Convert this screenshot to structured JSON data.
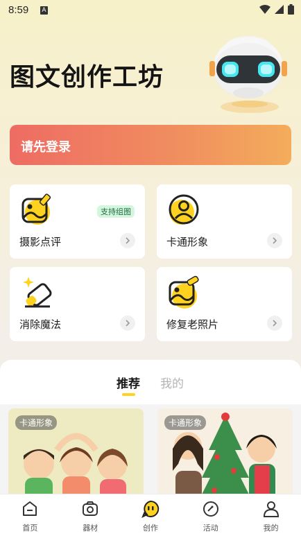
{
  "status": {
    "time": "8:59",
    "notif": "A"
  },
  "hero": {
    "title": "图文创作工坊"
  },
  "login": {
    "label": "请先登录"
  },
  "features": [
    {
      "label": "摄影点评",
      "badge": "支持组图",
      "icon": "photo-review-icon"
    },
    {
      "label": "卡通形象",
      "icon": "cartoon-avatar-icon"
    },
    {
      "label": "消除魔法",
      "icon": "eraser-magic-icon"
    },
    {
      "label": "修复老照片",
      "icon": "photo-restore-icon"
    }
  ],
  "tabs": {
    "recommended": "推荐",
    "mine": "我的"
  },
  "feed": [
    {
      "tag": "卡通形象"
    },
    {
      "tag": "卡通形象"
    }
  ],
  "nav": [
    {
      "label": "首页",
      "icon": "home-icon"
    },
    {
      "label": "器材",
      "icon": "camera-icon"
    },
    {
      "label": "创作",
      "icon": "create-icon",
      "active": true
    },
    {
      "label": "活动",
      "icon": "activity-icon"
    },
    {
      "label": "我的",
      "icon": "profile-icon"
    }
  ],
  "colors": {
    "accent": "#ffd21f",
    "login_start": "#ee6c63",
    "login_end": "#f3ad5b"
  }
}
